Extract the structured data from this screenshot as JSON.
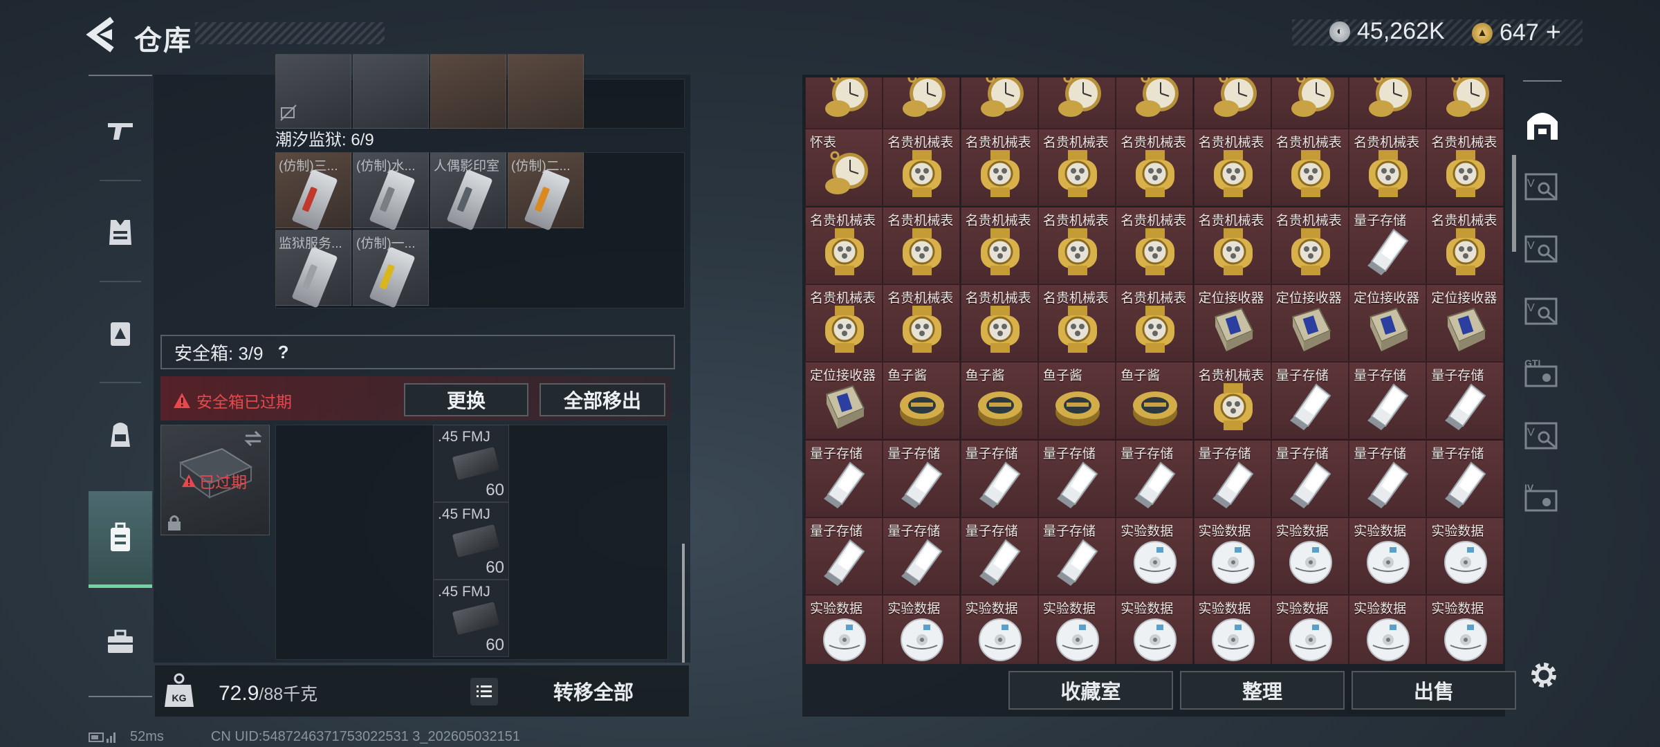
{
  "header": {
    "title": "仓库",
    "currency_silver": "45,262K",
    "currency_gold": "647",
    "currency_gold_plus": "+"
  },
  "nav": {
    "items": [
      "weapon-icon",
      "armor-vest-icon",
      "rig-icon",
      "backpack-icon",
      "safe-case-icon",
      "toolbox-icon"
    ],
    "active_index": 4
  },
  "backpack": {
    "prison_label": "潮汐监狱: 6/9",
    "keycards": [
      {
        "name": "(仿制)三...",
        "stripe": "#c0392b"
      },
      {
        "name": "(仿制)水...",
        "stripe": "#7a7f86"
      },
      {
        "name": "人偶影印室",
        "stripe": "#5a6068"
      },
      {
        "name": "(仿制)二...",
        "stripe": "#d9891e"
      },
      {
        "name": "监狱服务...",
        "stripe": "#9aa0a6"
      },
      {
        "name": "(仿制)一...",
        "stripe": "#d9b61e"
      }
    ],
    "safe_label": "安全箱: 3/9",
    "safe_help": "?",
    "expired_warning": "安全箱已过期",
    "replace_button": "更换",
    "remove_all_button": "全部移出",
    "expired_badge": "已过期",
    "ammo": [
      {
        "caliber": ".45 FMJ",
        "count": "60"
      },
      {
        "caliber": ".45 FMJ",
        "count": "60"
      },
      {
        "caliber": ".45 FMJ",
        "count": "60"
      }
    ]
  },
  "weight": {
    "current": "72.9",
    "max": "/88千克",
    "kg_icon_text": "KG"
  },
  "transfer_all_button": "转移全部",
  "status": {
    "ping": "52ms",
    "uid": "CN UID:5487246371753022531 3_202605032151"
  },
  "warehouse": {
    "rows": [
      [
        "怀表",
        "怀表",
        "怀表",
        "怀表",
        "怀表",
        "怀表",
        "怀表",
        "怀表",
        "怀表"
      ],
      [
        "怀表",
        "名贵机械表",
        "名贵机械表",
        "名贵机械表",
        "名贵机械表",
        "名贵机械表",
        "名贵机械表",
        "名贵机械表",
        "名贵机械表"
      ],
      [
        "名贵机械表",
        "名贵机械表",
        "名贵机械表",
        "名贵机械表",
        "名贵机械表",
        "名贵机械表",
        "名贵机械表",
        "量子存储",
        "名贵机械表"
      ],
      [
        "名贵机械表",
        "名贵机械表",
        "名贵机械表",
        "名贵机械表",
        "名贵机械表",
        "定位接收器",
        "定位接收器",
        "定位接收器",
        "定位接收器"
      ],
      [
        "定位接收器",
        "鱼子酱",
        "鱼子酱",
        "鱼子酱",
        "鱼子酱",
        "名贵机械表",
        "量子存储",
        "量子存储",
        "量子存储"
      ],
      [
        "量子存储",
        "量子存储",
        "量子存储",
        "量子存储",
        "量子存储",
        "量子存储",
        "量子存储",
        "量子存储",
        "量子存储"
      ],
      [
        "量子存储",
        "量子存储",
        "量子存储",
        "量子存储",
        "实验数据",
        "实验数据",
        "实验数据",
        "实验数据",
        "实验数据"
      ],
      [
        "实验数据",
        "实验数据",
        "实验数据",
        "实验数据",
        "实验数据",
        "实验数据",
        "实验数据",
        "实验数据",
        "实验数据"
      ]
    ],
    "collection_button": "收藏室",
    "sort_button": "整理",
    "sell_button": "出售"
  },
  "right_tabs": [
    "warehouse-main-icon",
    "storage-v-icon",
    "storage-v-icon",
    "storage-v-icon",
    "storage-gti-icon",
    "storage-v-icon",
    "storage-iv-icon"
  ],
  "right_tab_labels": {
    "gti": "GTI",
    "iv": "IV",
    "v": "V"
  }
}
